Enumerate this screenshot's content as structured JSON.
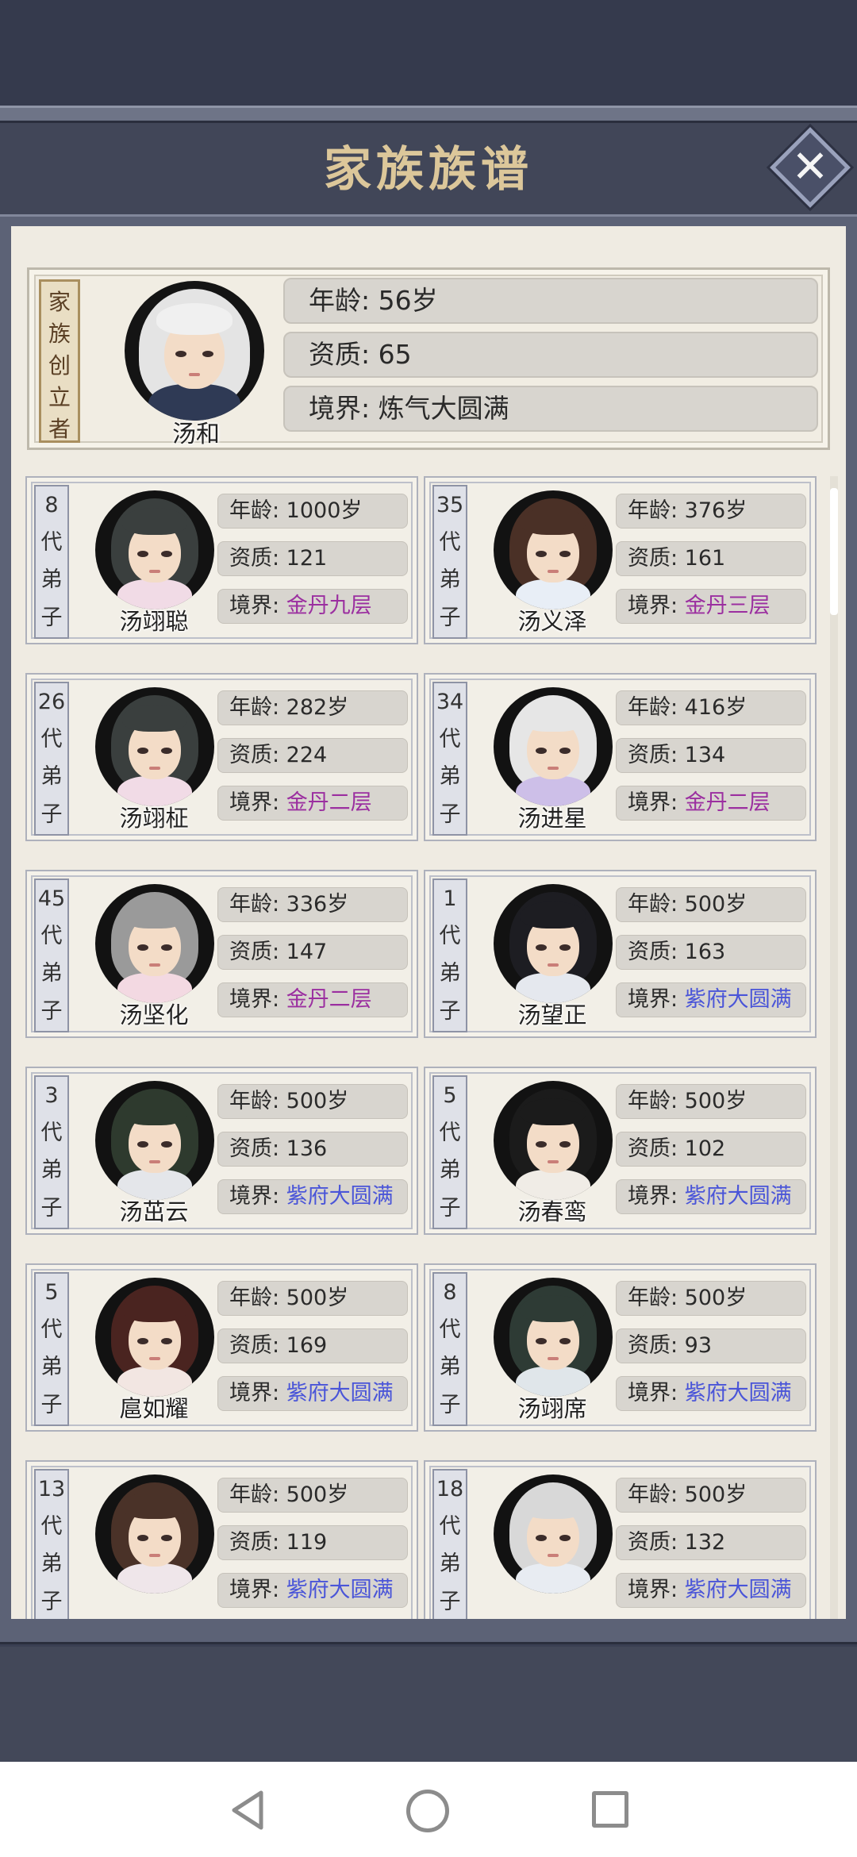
{
  "header": {
    "title": "家族族谱",
    "close_icon": "close-icon"
  },
  "founder": {
    "tag": [
      "家",
      "族",
      "创",
      "立",
      "者"
    ],
    "name": "汤和",
    "age": "年龄:  56岁",
    "aptitude": "资质:   65",
    "realm": "境界:  炼气大圆满"
  },
  "labels": {
    "age": "年龄:",
    "aptitude": "资质:",
    "realm": "境界:",
    "gen_suffix": [
      "代",
      "弟",
      "子"
    ],
    "age_unit": "岁"
  },
  "members": [
    {
      "gen": "8",
      "name": "汤翊聪",
      "age": "年龄: 1000岁",
      "aptitude": "资质: 121",
      "realm_label": "境界: ",
      "realm": "金丹九层",
      "tier": "gold",
      "hair": "#3a3f3e",
      "robe": "#f1dbe6"
    },
    {
      "gen": "35",
      "name": "汤义泽",
      "age": "年龄: 376岁",
      "aptitude": "资质: 161",
      "realm_label": "境界: ",
      "realm": "金丹三层",
      "tier": "gold",
      "hair": "#4a3026",
      "robe": "#e8eef6"
    },
    {
      "gen": "26",
      "name": "汤翊柾",
      "age": "年龄: 282岁",
      "aptitude": "资质: 224",
      "realm_label": "境界: ",
      "realm": "金丹二层",
      "tier": "gold",
      "hair": "#3a3f3e",
      "robe": "#f1dbe6"
    },
    {
      "gen": "34",
      "name": "汤进星",
      "age": "年龄: 416岁",
      "aptitude": "资质: 134",
      "realm_label": "境界: ",
      "realm": "金丹二层",
      "tier": "gold",
      "hair": "#e6e6e6",
      "robe": "#cdbfe8"
    },
    {
      "gen": "45",
      "name": "汤坚化",
      "age": "年龄: 336岁",
      "aptitude": "资质: 147",
      "realm_label": "境界: ",
      "realm": "金丹二层",
      "tier": "gold",
      "hair": "#9a9a9a",
      "robe": "#f3d9e2"
    },
    {
      "gen": "1",
      "name": "汤望正",
      "age": "年龄: 500岁",
      "aptitude": "资质: 163",
      "realm_label": "境界: ",
      "realm": "紫府大圆满",
      "tier": "purple",
      "hair": "#1d1d22",
      "robe": "#e5e8ee"
    },
    {
      "gen": "3",
      "name": "汤茁云",
      "age": "年龄: 500岁",
      "aptitude": "资质: 136",
      "realm_label": "境界: ",
      "realm": "紫府大圆满",
      "tier": "purple",
      "hair": "#2e3a2e",
      "robe": "#e4e6ea"
    },
    {
      "gen": "5",
      "name": "汤春鸾",
      "age": "年龄: 500岁",
      "aptitude": "资质: 102",
      "realm_label": "境界: ",
      "realm": "紫府大圆满",
      "tier": "purple",
      "hair": "#1b1b1b",
      "robe": "#f0ece6"
    },
    {
      "gen": "5",
      "name": "扈如耀",
      "age": "年龄: 500岁",
      "aptitude": "资质: 169",
      "realm_label": "境界: ",
      "realm": "紫府大圆满",
      "tier": "purple",
      "hair": "#4a2420",
      "robe": "#f2e6e2"
    },
    {
      "gen": "8",
      "name": "汤翊席",
      "age": "年龄: 500岁",
      "aptitude": "资质: 93",
      "realm_label": "境界: ",
      "realm": "紫府大圆满",
      "tier": "purple",
      "hair": "#2e3b35",
      "robe": "#e0e6ea"
    },
    {
      "gen": "13",
      "name": "",
      "age": "年龄: 500岁",
      "aptitude": "资质: 119",
      "realm_label": "境界: ",
      "realm": "紫府大圆满",
      "tier": "purple",
      "hair": "#4a3228",
      "robe": "#efe6ea"
    },
    {
      "gen": "18",
      "name": "",
      "age": "年龄: 500岁",
      "aptitude": "资质: 132",
      "realm_label": "境界: ",
      "realm": "紫府大圆满",
      "tier": "purple",
      "hair": "#d8d8d8",
      "robe": "#e8ecf2"
    }
  ],
  "colors": {
    "gold_realm": "#9b2fa0",
    "purple_realm": "#4a55d8",
    "panel": "#efebe2",
    "frame": "#3a3f52"
  },
  "navbar": {
    "back_icon": "back-triangle-icon",
    "home_icon": "home-circle-icon",
    "recent_icon": "recent-square-icon"
  }
}
